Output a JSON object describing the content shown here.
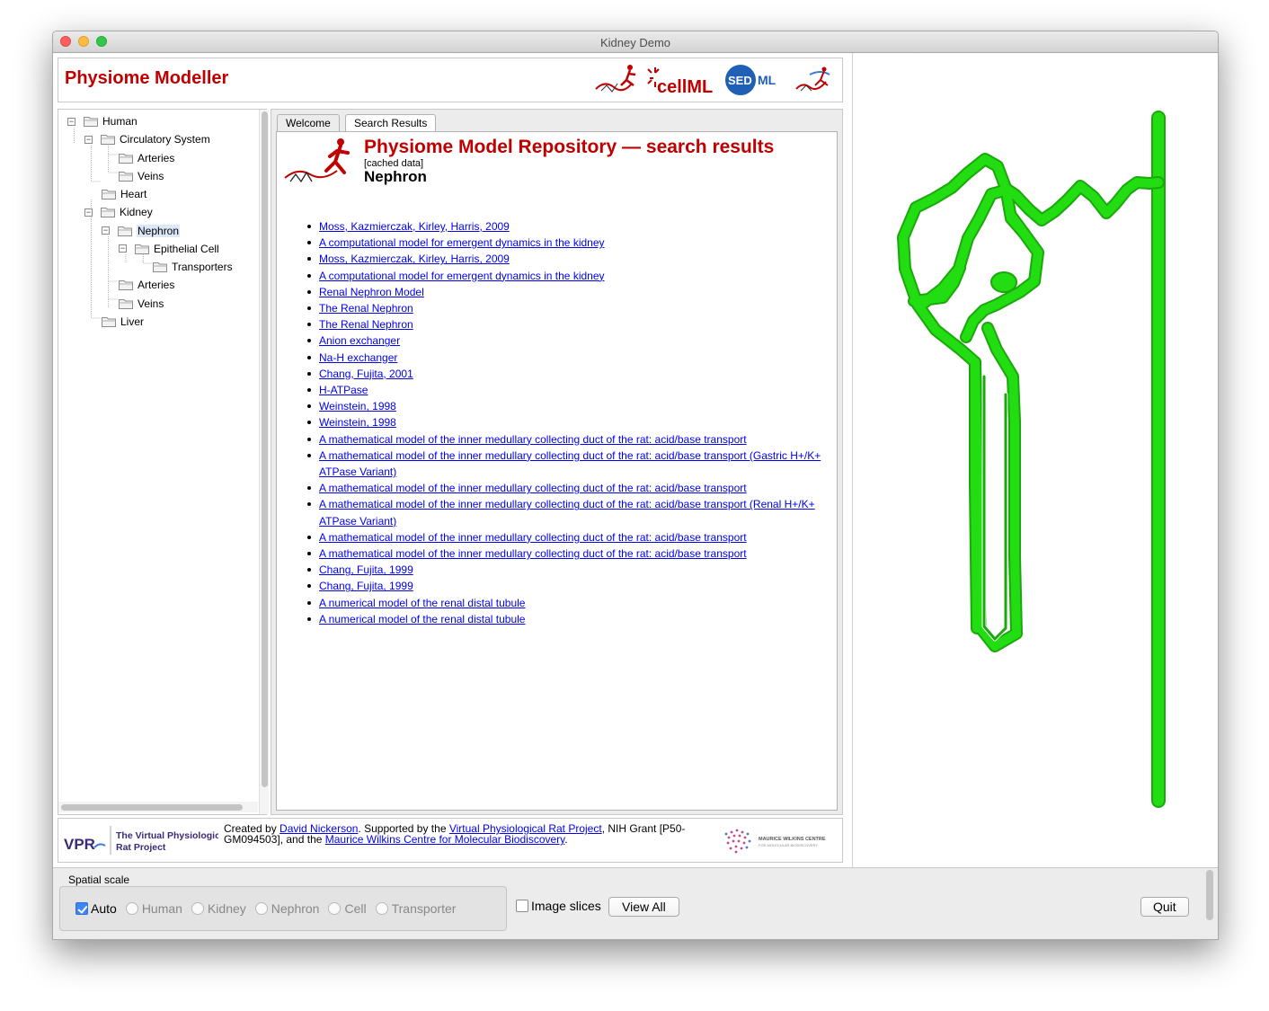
{
  "window": {
    "title": "Kidney Demo"
  },
  "header": {
    "app_title": "Physiome Modeller",
    "logo_cellml": "cellML",
    "logo_sed": "SED",
    "logo_ml": "ML"
  },
  "tree": {
    "items": [
      {
        "label": "Human",
        "level": 0,
        "toggle": "−"
      },
      {
        "label": "Circulatory System",
        "level": 1,
        "toggle": "−"
      },
      {
        "label": "Arteries",
        "level": 2,
        "toggle": ""
      },
      {
        "label": "Veins",
        "level": 2,
        "toggle": ""
      },
      {
        "label": "Heart",
        "level": 1,
        "toggle": ""
      },
      {
        "label": "Kidney",
        "level": 1,
        "toggle": "−"
      },
      {
        "label": "Nephron",
        "level": 2,
        "toggle": "−",
        "selected": true
      },
      {
        "label": "Epithelial Cell",
        "level": 3,
        "toggle": "−"
      },
      {
        "label": "Transporters",
        "level": 4,
        "toggle": ""
      },
      {
        "label": "Arteries",
        "level": 2,
        "toggle": ""
      },
      {
        "label": "Veins",
        "level": 2,
        "toggle": ""
      },
      {
        "label": "Liver",
        "level": 1,
        "toggle": ""
      }
    ]
  },
  "tabs": {
    "welcome": "Welcome",
    "search_results": "Search Results"
  },
  "results": {
    "title": "Physiome Model Repository — search results",
    "cached": "[cached data]",
    "subtitle": "Nephron",
    "items": [
      "Moss, Kazmierczak, Kirley, Harris, 2009",
      "A computational model for emergent dynamics in the kidney",
      "Moss, Kazmierczak, Kirley, Harris, 2009",
      "A computational model for emergent dynamics in the kidney",
      "Renal Nephron Model",
      "The Renal Nephron",
      "The Renal Nephron",
      "Anion exchanger",
      "Na-H exchanger",
      "Chang, Fujita, 2001",
      "H-ATPase",
      "Weinstein, 1998",
      "Weinstein, 1998",
      "A mathematical model of the inner medullary collecting duct of the rat: acid/base transport",
      "A mathematical model of the inner medullary collecting duct of the rat: acid/base transport (Gastric H+/K+ ATPase Variant)",
      "A mathematical model of the inner medullary collecting duct of the rat: acid/base transport",
      "A mathematical model of the inner medullary collecting duct of the rat: acid/base transport (Renal H+/K+ ATPase Variant)",
      "A mathematical model of the inner medullary collecting duct of the rat: acid/base transport",
      "A mathematical model of the inner medullary collecting duct of the rat: acid/base transport",
      "Chang, Fujita, 1999",
      "Chang, Fujita, 1999",
      "A numerical model of the renal distal tubule",
      "A numerical model of the renal distal tubule"
    ]
  },
  "footer": {
    "vpr_abbrev": "VPR",
    "vpr_name_line1": "The Virtual Physiological",
    "vpr_name_line2": "Rat Project",
    "created_by": "Created by ",
    "author_link": "David Nickerson",
    "supported_by": ". Supported by the ",
    "vpr_link": "Virtual Physiological Rat Project",
    "grant": ", NIH Grant [P50-GM094503], and the ",
    "mwc_link": "Maurice Wilkins Centre for Molecular Biodiscovery",
    "end": ".",
    "mwc_logo_line1": "MAURICE WILKINS CENTRE",
    "mwc_logo_line2": "FOR MOLECULAR BIODISCOVERY"
  },
  "controls": {
    "spatial_scale_label": "Spatial scale",
    "auto_label": "Auto",
    "auto_checked": true,
    "scales": [
      "Human",
      "Kidney",
      "Nephron",
      "Cell",
      "Transporter"
    ],
    "image_slices_label": "Image slices",
    "image_slices_checked": false,
    "view_all_label": "View All",
    "quit_label": "Quit"
  },
  "colors": {
    "brand_red": "#c00000",
    "link_blue": "#0000ee",
    "nephron_green": "#22dd11"
  }
}
